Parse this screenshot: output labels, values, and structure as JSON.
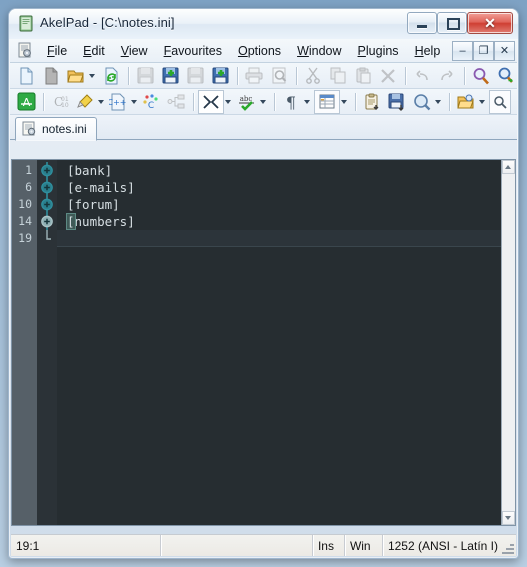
{
  "window": {
    "title": "AkelPad - [C:\\notes.ini]",
    "controls": {
      "minimize": "–",
      "maximize": "□",
      "close": "✕"
    }
  },
  "menubar": {
    "items": [
      {
        "name": "file",
        "pre": "",
        "acc": "F",
        "post": "ile"
      },
      {
        "name": "edit",
        "pre": "",
        "acc": "E",
        "post": "dit"
      },
      {
        "name": "view",
        "pre": "",
        "acc": "V",
        "post": "iew"
      },
      {
        "name": "favourites",
        "pre": "",
        "acc": "F",
        "post": "avourites"
      },
      {
        "name": "options",
        "pre": "",
        "acc": "O",
        "post": "ptions"
      },
      {
        "name": "window",
        "pre": "",
        "acc": "W",
        "post": "indow"
      },
      {
        "name": "plugins",
        "pre": "",
        "acc": "P",
        "post": "lugins"
      },
      {
        "name": "help",
        "pre": "",
        "acc": "H",
        "post": "elp"
      }
    ],
    "mdi_controls": {
      "minimize": "–",
      "restore": "❐",
      "close": "✕"
    }
  },
  "toolbar_main": {
    "buttons": [
      "new-file-icon",
      "new-window-icon",
      "open-file-icon",
      "open-dropdown-caret",
      "reload-file-icon",
      "sep",
      "save-icon",
      "save-copy-icon",
      "save-as-icon",
      "save-all-icon",
      "sep",
      "print-icon",
      "print-preview-icon",
      "sep",
      "cut-icon",
      "copy-icon",
      "paste-icon",
      "delete-icon",
      "sep",
      "undo-icon",
      "redo-icon",
      "sep",
      "find-icon",
      "find-next-icon"
    ]
  },
  "toolbar_coder": {
    "buttons": [
      "coder-toggle-icon",
      "sep",
      "goto-line-icon",
      "highlight-icon",
      "cpp-snippet-icon",
      "color-picker-icon",
      "tree-view-icon",
      "sep",
      "fold-toggle-icon",
      "fold-caret",
      "spellcheck-icon",
      "spell-caret",
      "sep",
      "pilcrow-icon",
      "pilcrow-caret",
      "columns-icon",
      "columns-caret",
      "sep",
      "clipboard-icon",
      "save-session-icon",
      "preview-icon",
      "preview-caret",
      "sep",
      "recent-folder-icon",
      "recent-caret",
      "quicksearch-icon"
    ]
  },
  "tabs": [
    {
      "label": "notes.ini",
      "icon": "document-icon",
      "active": true
    }
  ],
  "editor": {
    "lines": [
      {
        "num": "1",
        "text": "[bank]",
        "fold": "collapsed",
        "current": false
      },
      {
        "num": "6",
        "text": "[e-mails]",
        "fold": "collapsed",
        "current": false
      },
      {
        "num": "10",
        "text": "[forum]",
        "fold": "collapsed",
        "current": false
      },
      {
        "num": "14",
        "text": "[numbers]",
        "fold": "collapsed-active",
        "current": false
      },
      {
        "num": "19",
        "text": "",
        "fold": "end",
        "current": true
      }
    ],
    "colors": {
      "background": "#262d31",
      "gutter": "#566068",
      "foldbar": "#2b3237",
      "text": "#d7dfe3",
      "fold_marker": "#2f8f9e",
      "current_line": "#2c343a"
    }
  },
  "statusbar": {
    "position": "19:1",
    "blank": "",
    "insert_mode": "Ins",
    "line_ending": "Win",
    "encoding": "1252  (ANSI - Latín I)"
  }
}
